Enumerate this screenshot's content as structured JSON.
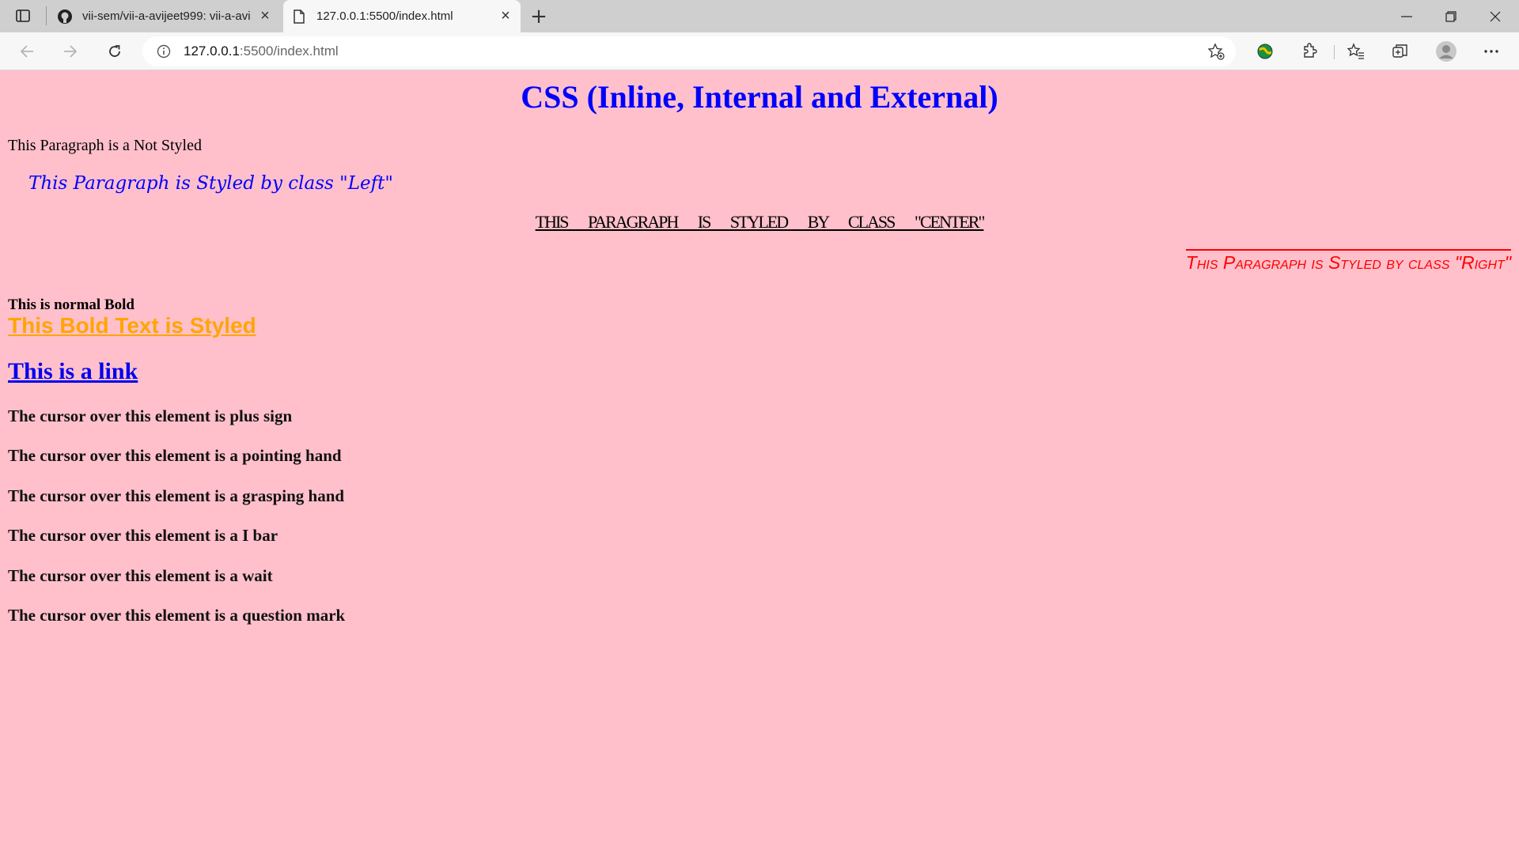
{
  "browser": {
    "tabs": [
      {
        "title": "vii-sem/vii-a-avijeet999: vii-a-avi",
        "active": false,
        "icon": "github-icon"
      },
      {
        "title": "127.0.0.1:5500/index.html",
        "active": true,
        "icon": "file-icon"
      }
    ],
    "new_tab_label": "+",
    "address": {
      "host": "127.0.0.1",
      "rest": ":5500/index.html"
    }
  },
  "page": {
    "title": "CSS (Inline, Internal and External)",
    "p_plain": "This Paragraph is a Not Styled",
    "p_left": "This Paragraph is Styled by class \"Left\"",
    "p_center": "This Paragraph is Styled by class \"Center\"",
    "p_right": "This Paragraph is Styled by class \"Right\"",
    "bold_normal": "This is normal Bold",
    "bold_styled": "This Bold Text is Styled",
    "link": "This is a link",
    "cursor_lines": [
      "The cursor over this element is plus sign",
      "The cursor over this element is a pointing hand",
      "The cursor over this element is a grasping hand",
      "The cursor over this element is a I bar",
      "The cursor over this element is a wait",
      "The cursor over this element is a question mark"
    ]
  },
  "colors": {
    "background": "#ffc0cb",
    "title": "#0000ff",
    "left": "#0000ff",
    "right": "#ff0000",
    "bold_styled": "#ffa500",
    "link": "#0000ee"
  }
}
